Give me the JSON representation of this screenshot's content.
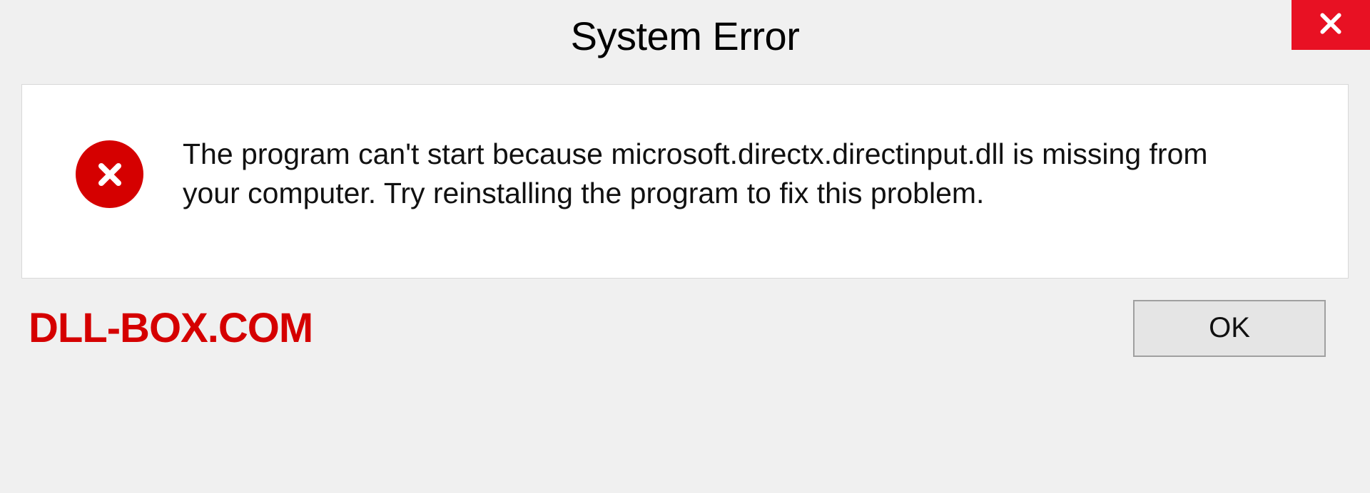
{
  "titlebar": {
    "title": "System Error"
  },
  "dialog": {
    "message": "The program can't start because microsoft.directx.directinput.dll is missing from your computer. Try reinstalling the program to fix this problem."
  },
  "footer": {
    "watermark": "DLL-BOX.COM",
    "ok_label": "OK"
  },
  "colors": {
    "close_red": "#e81123",
    "error_red": "#d50000",
    "panel_bg": "#ffffff",
    "body_bg": "#f0f0f0"
  }
}
